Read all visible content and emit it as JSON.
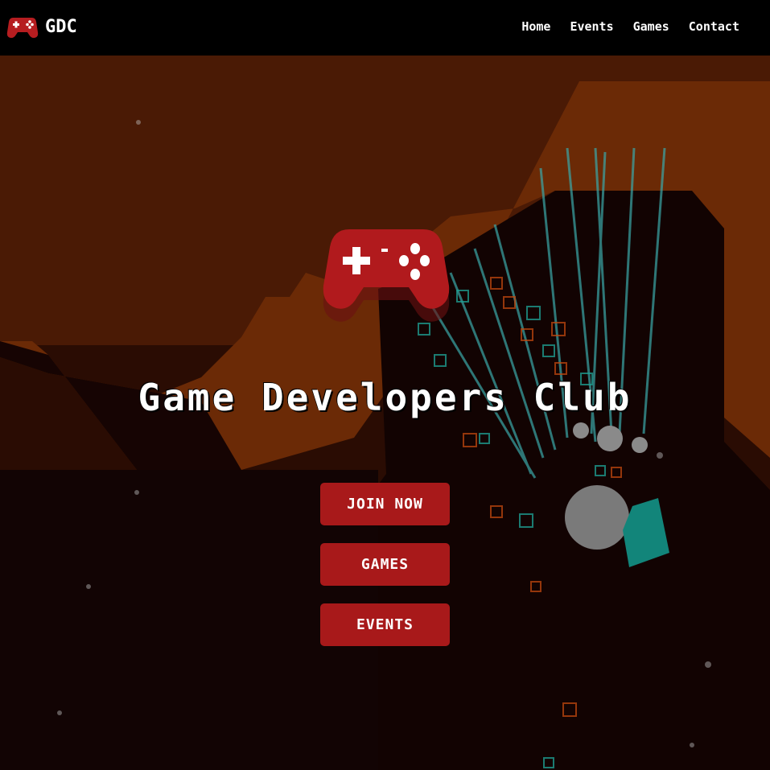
{
  "nav": {
    "brand": "GDC",
    "links": [
      "Home",
      "Events",
      "Games",
      "Contact"
    ]
  },
  "hero": {
    "title": "Game Developers Club",
    "buttons": [
      "JOIN NOW",
      "GAMES",
      "EVENTS"
    ]
  },
  "icons": {
    "brand": "gamepad-icon",
    "hero": "gamepad-icon"
  },
  "colors": {
    "navbar": "#000000",
    "accent": "#a8191a",
    "background": "#120404",
    "orange": "#6b2a06",
    "teal": "#1ea396"
  }
}
